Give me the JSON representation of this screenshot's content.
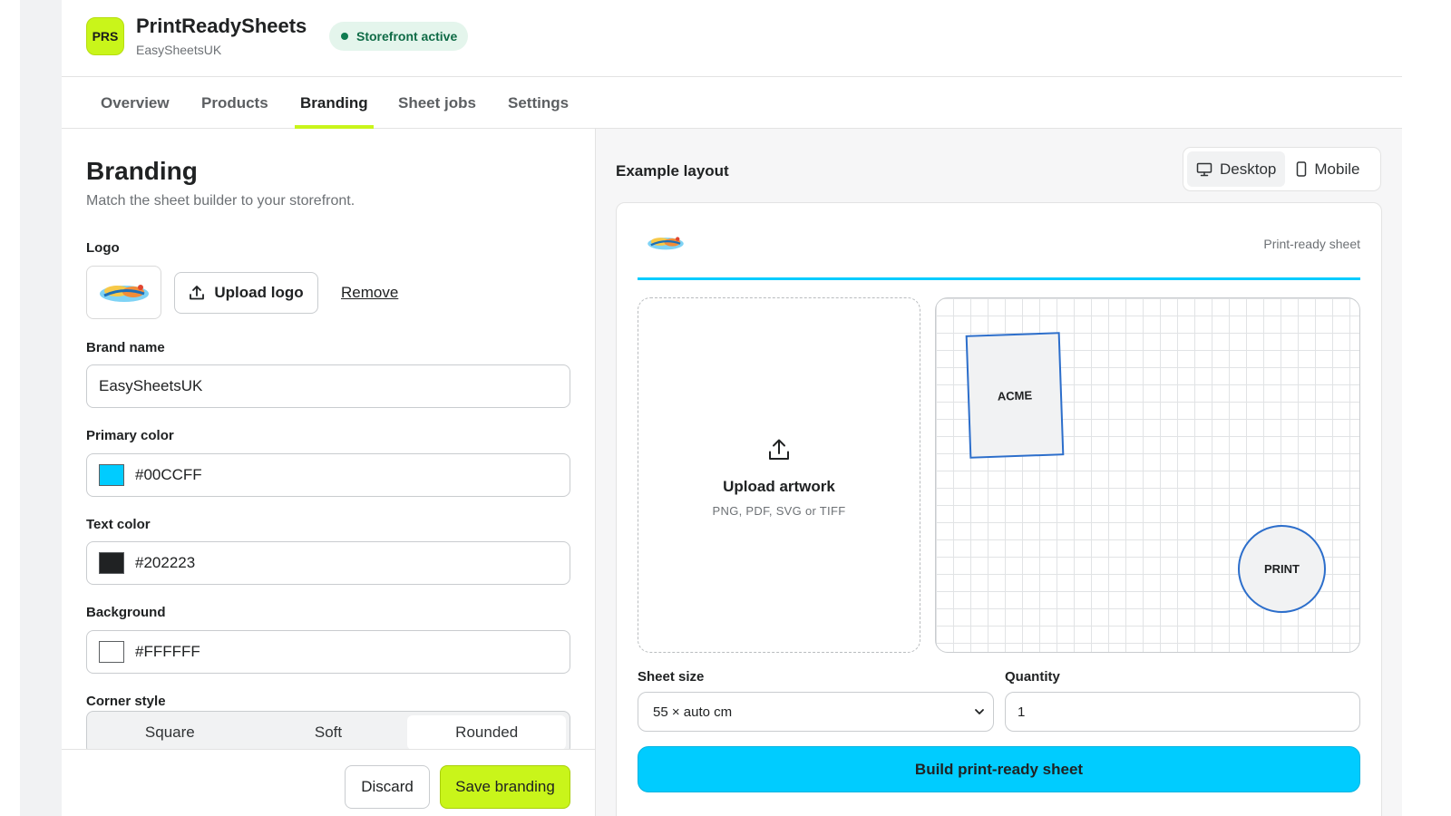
{
  "app": {
    "badge": "PRS",
    "title": "PrintReadySheets",
    "subtitle": "EasySheetsUK",
    "status": "Storefront active"
  },
  "tabs": [
    {
      "label": "Overview"
    },
    {
      "label": "Products"
    },
    {
      "label": "Branding",
      "active": true
    },
    {
      "label": "Sheet jobs"
    },
    {
      "label": "Settings"
    }
  ],
  "branding": {
    "title": "Branding",
    "description": "Match the sheet builder to your storefront.",
    "logo_label": "Logo",
    "upload_logo_label": "Upload logo",
    "remove_label": "Remove",
    "brand_name_label": "Brand name",
    "brand_name_value": "EasySheetsUK",
    "primary_color_label": "Primary color",
    "primary_color_value": "#00CCFF",
    "text_color_label": "Text color",
    "text_color_value": "#202223",
    "background_label": "Background",
    "background_value": "#FFFFFF",
    "corner_style_label": "Corner style",
    "corner_options": [
      "Square",
      "Soft",
      "Rounded"
    ],
    "corner_selected": "Rounded",
    "discard_label": "Discard",
    "save_label": "Save branding"
  },
  "preview": {
    "heading": "Example layout",
    "device_desktop": "Desktop",
    "device_mobile": "Mobile",
    "device_selected": "Desktop",
    "tagline": "Print-ready sheet",
    "upload_title": "Upload artwork",
    "upload_formats": "PNG, PDF, SVG or TIFF",
    "art_items": [
      "ACME",
      "PRINT"
    ],
    "sheet_size_label": "Sheet size",
    "sheet_size_value": "55 × auto cm",
    "quantity_label": "Quantity",
    "quantity_value": "1",
    "build_label": "Build print-ready sheet"
  },
  "colors": {
    "accent": "#C9F51A",
    "primary": "#00CCFF",
    "text": "#202223",
    "background": "#FFFFFF",
    "status_bg": "#E4F5EC",
    "status_text": "#0F6B46",
    "art_border": "#2C6ECB"
  },
  "icons": {
    "upload_logo": "upload-icon",
    "upload_artwork": "upload-icon",
    "desktop": "monitor-icon",
    "mobile": "phone-icon",
    "select": "chevron-down-icon"
  }
}
